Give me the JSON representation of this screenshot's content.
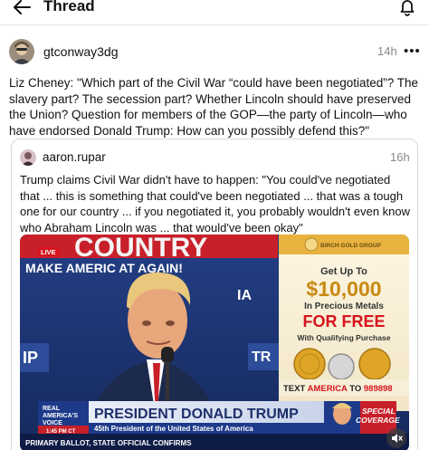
{
  "header": {
    "title": "Thread",
    "back_icon": "arrow-left-icon",
    "notifications_icon": "bell-icon"
  },
  "post": {
    "username": "gtconway3dg",
    "timestamp": "14h",
    "more_label": "•••",
    "text": "Liz Cheney: \"Which part of the Civil War “could have been negotiated”? The slavery part? The secession part?  Whether Lincoln should have preserved the Union? Question for members of the GOP—the party of Lincoln—who have endorsed Donald Trump: How can you possibly defend this?\""
  },
  "quoted_post": {
    "username": "aaron.rupar",
    "timestamp": "16h",
    "text": "Trump claims Civil War didn't have to happen: \"You could've negotiated that ... this is something that could've been negotiated ... that was a tough one for our country ... if you negotiated it, you probably wouldn't even know who Abraham Lincoln was ... that would've been okay\"",
    "video": {
      "backdrop_top": "COUNTRY",
      "backdrop_slogan": "MAKE AMERIC      AT AGAIN!",
      "backdrop_ia": "IA",
      "backdrop_left": "IP",
      "backdrop_right": "TR",
      "live_badge": "LIVE",
      "ad": {
        "brand": "BIRCH GOLD GROUP",
        "line1": "Get Up To",
        "amount": "$10,000",
        "line2": "In Precious Metals",
        "line3": "FOR FREE",
        "line4": "With Qualifying Purchase",
        "text_prompt": "TEXT",
        "text_keyword": "AMERICA",
        "text_to": "TO",
        "text_number": "989898"
      },
      "chyron": {
        "network_line1": "REAL",
        "network_line2": "AMERICA'S",
        "network_line3": "VOICE",
        "time": "1:45 PM CT",
        "headline": "PRESIDENT DONALD TRUMP",
        "subtitle": "45th President of the United States of America",
        "ticker": "PRIMARY BALLOT, STATE OFFICIAL CONFIRMS",
        "special_line1": "SPECIAL",
        "special_line2": "COVERAGE"
      },
      "sound_icon": "mute-speaker-icon"
    }
  },
  "colors": {
    "background": "#ffffff",
    "text": "#111111",
    "muted": "#888888",
    "border": "#d9d9d9",
    "video_blue": "#1f3e83",
    "banner_red": "#c8202a",
    "ad_gold": "#e8b23e"
  }
}
